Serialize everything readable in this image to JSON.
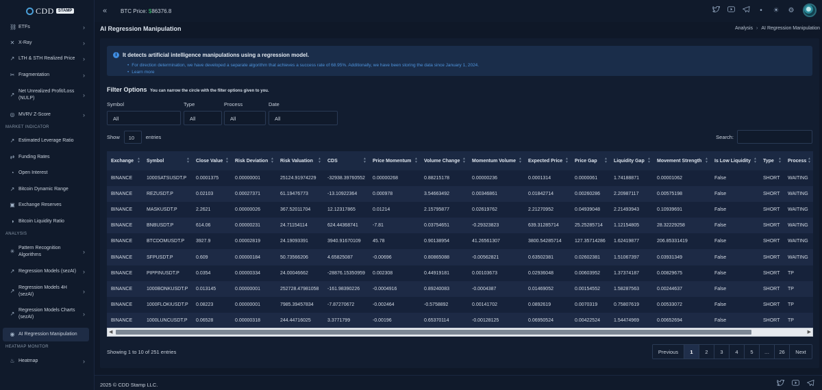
{
  "app": {
    "logo_text": "CDD",
    "logo_badge": "STAMP"
  },
  "topbar": {
    "btc_label": "BTC Price:",
    "btc_currency": "$",
    "btc_value": "86376.8",
    "icons": [
      "twitter-icon",
      "youtube-icon",
      "telegram-icon",
      "dot-icon",
      "theme-icon",
      "settings-icon"
    ]
  },
  "sidebar": {
    "items": [
      {
        "label": "ETFs",
        "icon": "link-icon",
        "chevron": true
      },
      {
        "label": "X-Ray",
        "icon": "xray-icon",
        "chevron": true
      },
      {
        "label": "LTH & STH Realized Price",
        "icon": "chart-icon",
        "chevron": true
      },
      {
        "label": "Fragmentation",
        "icon": "fragment-icon",
        "chevron": true
      },
      {
        "label": "Net Unrealized Profit/Loss (NULP)",
        "icon": "trend-icon",
        "chevron": true
      },
      {
        "label": "MVRV Z-Score",
        "icon": "target-icon",
        "chevron": true
      }
    ],
    "section_market": "MARKET INDICATOR",
    "market_items": [
      {
        "label": "Estimated Leverage Ratio",
        "icon": "trend-icon"
      },
      {
        "label": "Funding Rates",
        "icon": "funding-icon"
      },
      {
        "label": "Open Interest",
        "icon": "interest-icon"
      },
      {
        "label": "Bitcoin Dynamic Range",
        "icon": "range-icon"
      },
      {
        "label": "Exchange Reserves",
        "icon": "reserve-icon"
      },
      {
        "label": "Bitcoin Liquidity Ratio",
        "icon": "liquidity-icon"
      }
    ],
    "section_analysis": "ANALYSIS",
    "analysis_items": [
      {
        "label": "Pattern Recognition Algorithms",
        "icon": "pattern-icon",
        "chevron": true
      },
      {
        "label": "Regression Models (sezAI)",
        "icon": "regression-icon",
        "chevron": true
      },
      {
        "label": "Regression Models 4H (sezAI)",
        "icon": "regression-icon",
        "chevron": true
      },
      {
        "label": "Regression Models Charts (sezAI)",
        "icon": "regression-icon",
        "chevron": true
      },
      {
        "label": "AI Regression Manipulation",
        "icon": "ai-icon",
        "chevron": false
      }
    ],
    "section_heatmap": "HEATMAP MONITOR",
    "heatmap_items": [
      {
        "label": "Heatmap",
        "icon": "fire-icon",
        "chevron": true
      }
    ]
  },
  "page": {
    "title": "AI Regression Manipulation",
    "breadcrumb": [
      "Analysis",
      "AI Regression Manipulation"
    ]
  },
  "info": {
    "title": "It detects artificial intelligence manipulations using a regression model.",
    "lines": [
      "For direction determination, we have developed a separate algorithm that achieves a success rate of 68.95%. Additionally, we have been storing the data since January 1, 2024.",
      "Learn more"
    ]
  },
  "filters": {
    "title": "Filter Options",
    "subtitle": "You can narrow the circle with the filter options given to you.",
    "fields": [
      {
        "label": "Symbol",
        "value": "All"
      },
      {
        "label": "Type",
        "value": "All"
      },
      {
        "label": "Process",
        "value": "All"
      },
      {
        "label": "Date",
        "value": "All"
      }
    ]
  },
  "table": {
    "show_label": "Show",
    "length": "10",
    "entries_label": "entries",
    "search_label": "Search:",
    "columns": [
      "Exchange",
      "Symbol",
      "Close Value",
      "Risk Deviation",
      "Risk Valuation",
      "CDS",
      "Price Momentum",
      "Volume Change",
      "Momentum Volume",
      "Expected Price",
      "Price Gap",
      "Liquidity Gap",
      "Movement Strength",
      "Is Low Liquidity",
      "Type",
      "Process"
    ],
    "rows": [
      [
        "BINANCE",
        "1000SATSUSDT.P",
        "0.0001375",
        "0.00000001",
        "25124.91974229",
        "-32938.39760552",
        "0.00000268",
        "0.88215178",
        "0.00000236",
        "0.0001314",
        "0.0000061",
        "1.74188871",
        "0.00001062",
        "False",
        "SHORT",
        "WAITING"
      ],
      [
        "BINANCE",
        "REZUSDT.P",
        "0.02103",
        "0.00027371",
        "61.19476773",
        "-13.10922364",
        "0.000978",
        "3.54663492",
        "0.00346861",
        "0.01842714",
        "0.00260286",
        "2.20987117",
        "0.00575198",
        "False",
        "SHORT",
        "WAITING"
      ],
      [
        "BINANCE",
        "MASKUSDT.P",
        "2.2621",
        "0.00000026",
        "367.52011704",
        "12.12317865",
        "0.01214",
        "2.15795877",
        "0.02619762",
        "2.21270952",
        "0.04939048",
        "2.21493943",
        "0.10939691",
        "False",
        "SHORT",
        "WAITING"
      ],
      [
        "BINANCE",
        "BNBUSDT.P",
        "614.06",
        "0.00000231",
        "24.71154114",
        "624.44368741",
        "-7.81",
        "0.03754651",
        "-0.29323823",
        "639.31285714",
        "25.25285714",
        "1.12154805",
        "28.32229258",
        "False",
        "SHORT",
        "WAITING"
      ],
      [
        "BINANCE",
        "BTCDOMUSDT.P",
        "3927.9",
        "0.00002819",
        "24.19093391",
        "3940.91670109",
        "45.78",
        "0.90138954",
        "41.26561307",
        "3800.54285714",
        "127.35714286",
        "1.62419877",
        "206.85331419",
        "False",
        "SHORT",
        "WAITING"
      ],
      [
        "BINANCE",
        "SFPUSDT.P",
        "0.609",
        "0.00000184",
        "50.73566206",
        "4.65825087",
        "-0.00696",
        "0.80865088",
        "-0.00562821",
        "0.63502381",
        "0.02602381",
        "1.51067397",
        "0.03931349",
        "False",
        "SHORT",
        "WAITING"
      ],
      [
        "BINANCE",
        "PIPPINUSDT.P",
        "0.0354",
        "0.00000334",
        "24.00046662",
        "-28876.15350959",
        "0.002308",
        "0.44919181",
        "0.00103673",
        "0.02936048",
        "0.00603952",
        "1.37374187",
        "0.00829675",
        "False",
        "SHORT",
        "TP"
      ],
      [
        "BINANCE",
        "1000BONKUSDT.P",
        "0.013145",
        "0.00000001",
        "252728.47981058",
        "-161.98390226",
        "-0.0004916",
        "0.89240083",
        "-0.0004387",
        "0.01469052",
        "0.00154552",
        "1.58287563",
        "0.00244637",
        "False",
        "SHORT",
        "TP"
      ],
      [
        "BINANCE",
        "1000FLOKIUSDT.P",
        "0.08223",
        "0.00000001",
        "7985.39457834",
        "-7.87270672",
        "-0.002464",
        "-0.5758892",
        "0.00141702",
        "0.0892619",
        "0.0070319",
        "0.75807619",
        "0.00533072",
        "False",
        "SHORT",
        "TP"
      ],
      [
        "BINANCE",
        "1000LUNCUSDT.P",
        "0.06528",
        "0.00000318",
        "244.44716025",
        "3.3771799",
        "-0.00196",
        "0.65370114",
        "-0.00128125",
        "0.06950524",
        "0.00422524",
        "1.54474969",
        "0.00652694",
        "False",
        "SHORT",
        "TP"
      ]
    ],
    "showing": "Showing 1 to 10 of 251 entries"
  },
  "pagination": [
    "Previous",
    "1",
    "2",
    "3",
    "4",
    "5",
    "…",
    "26",
    "Next"
  ],
  "pagination_active": "1",
  "footer": {
    "text": "2025 © CDD Stamp LLC."
  },
  "colors": {
    "background": "#0f1828",
    "sidebar": "#101a2b",
    "accent": "#3f8ce0",
    "price_currency": "#3ec46d"
  }
}
